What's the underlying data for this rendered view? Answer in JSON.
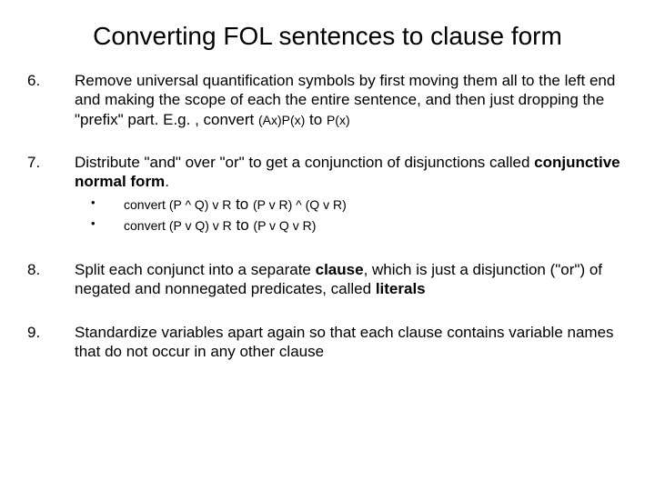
{
  "title": "Converting FOL sentences to clause form",
  "items": {
    "i6": {
      "num": "6.",
      "text_a": "Remove universal quantification symbols by first moving them all to the left end and making the scope of each the entire sentence, and then just dropping the \"prefix\" part. E.g. , convert ",
      "formula_a": "(Ax)P(x)",
      "to": " to ",
      "formula_b": "P(x)"
    },
    "i7": {
      "num": "7.",
      "text_a": "Distribute \"and\" over \"or\" to get a conjunction of disjunctions called ",
      "bold": "conjunctive normal form",
      "text_b": ".",
      "sub": {
        "a": {
          "lead": "convert ",
          "f1": "(P ^ Q) v R",
          "to": " to ",
          "f2": "(P v R) ^ (Q v R)"
        },
        "b": {
          "lead": "convert ",
          "f1": "(P v Q) v R",
          "to": " to ",
          "f2": "(P v Q v R)"
        }
      }
    },
    "i8": {
      "num": "8.",
      "text_a": "Split each conjunct into a separate ",
      "bold_a": "clause",
      "text_b": ", which is just a disjunction (\"or\") of negated and nonnegated predicates, called ",
      "bold_b": "literals"
    },
    "i9": {
      "num": "9.",
      "text": "Standardize variables apart again so that each clause contains variable names that do not occur in any other clause"
    }
  }
}
